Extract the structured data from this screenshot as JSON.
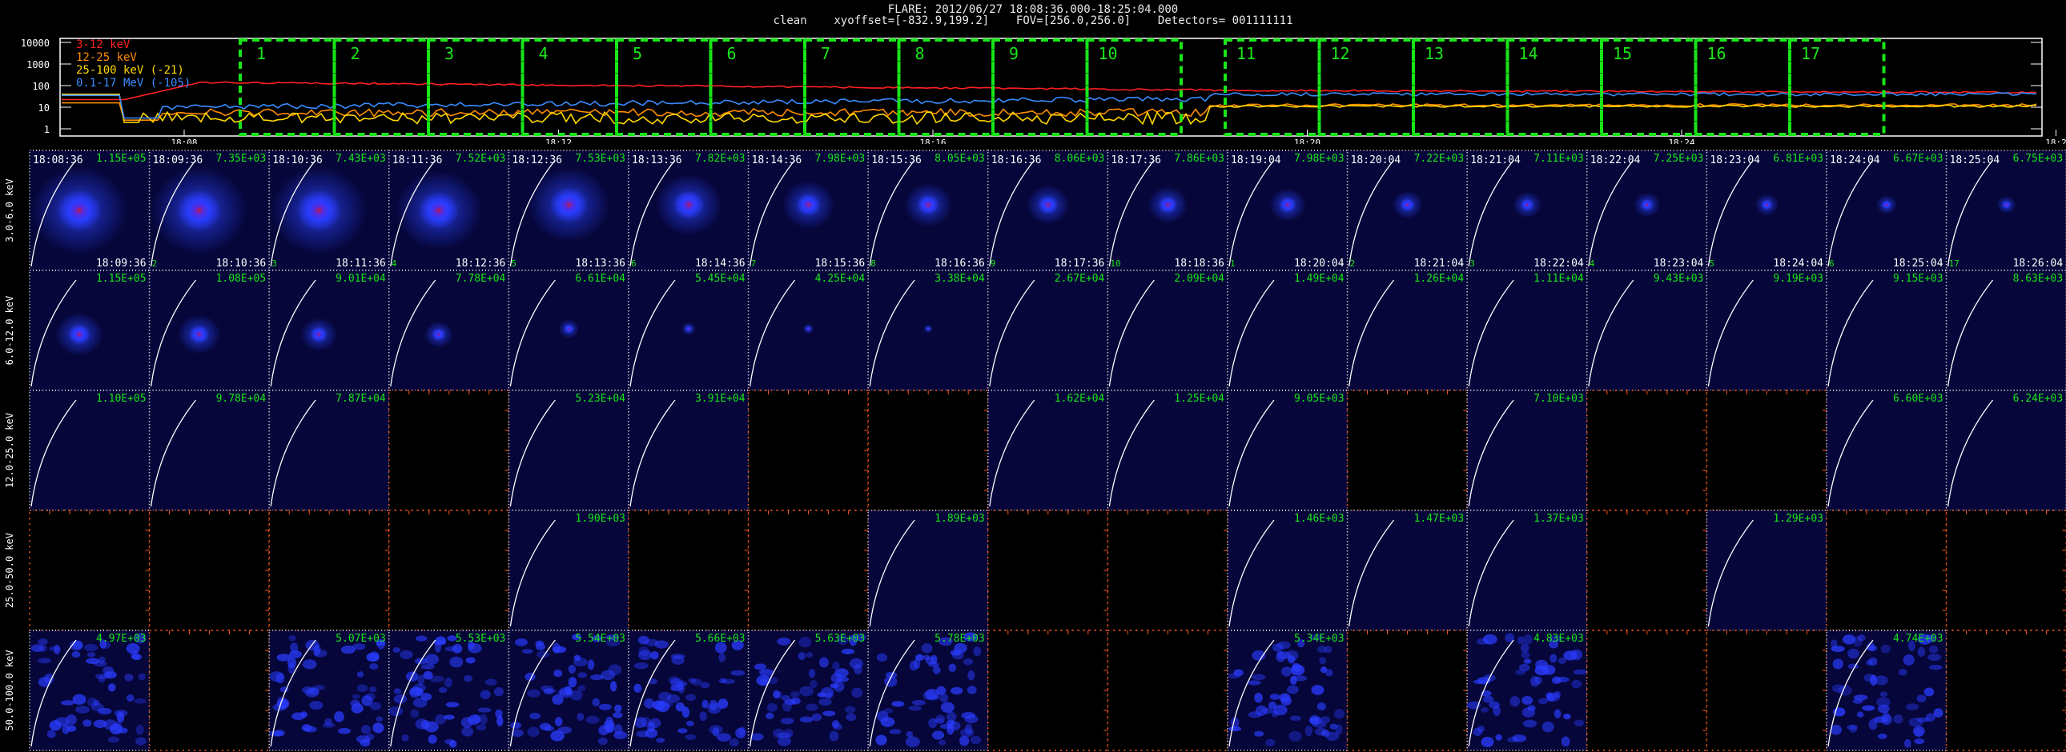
{
  "header": {
    "flare_line": "FLARE: 2012/06/27 18:08:36.000-18:25:04.000",
    "info_line": "clean    xyoffset=[-832.9,199.2]    FOV=[256.0,256.0]    Detectors= 001111111"
  },
  "lightcurve": {
    "legend": [
      {
        "label": "3-12 keV",
        "color": "#ff2020"
      },
      {
        "label": "12-25 keV",
        "color": "#ff8c00"
      },
      {
        "label": "25-100 keV (-21)",
        "color": "#ffd800"
      },
      {
        "label": "0.1-17 MeV (-105)",
        "color": "#3a8cff"
      }
    ],
    "y_ticks": [
      "10000",
      "1000",
      "100",
      "10",
      "1"
    ],
    "time_ticks": [
      "18:08",
      "18:12",
      "18:16",
      "18:20",
      "18:24",
      "18:2"
    ],
    "intervals": [
      "1",
      "2",
      "3",
      "4",
      "5",
      "6",
      "7",
      "8",
      "9",
      "10",
      "11",
      "12",
      "13",
      "14",
      "15",
      "16",
      "17"
    ],
    "interval_color": "#19e619"
  },
  "energy_bands": [
    "3.0-6.0 keV",
    "6.0-12.0 keV",
    "12.0-25.0 keV",
    "25.0-50.0 keV",
    "50.0-100.0 keV"
  ],
  "rows": [
    {
      "starts": [
        "18:08:36",
        "18:09:36",
        "18:10:36",
        "18:11:36",
        "18:12:36",
        "18:13:36",
        "18:14:36",
        "18:15:36",
        "18:16:36",
        "18:17:36",
        "18:19:04",
        "18:20:04",
        "18:21:04",
        "18:22:04",
        "18:23:04",
        "18:24:04",
        "18:25:04"
      ],
      "ends": [
        "18:09:36",
        "18:10:36",
        "18:11:36",
        "18:12:36",
        "18:13:36",
        "18:14:36",
        "18:15:36",
        "18:16:36",
        "18:17:36",
        "18:18:36",
        "18:20:04",
        "18:21:04",
        "18:22:04",
        "18:23:04",
        "18:24:04",
        "18:25:04",
        "18:26:04"
      ],
      "values": [
        "1.15E+05",
        "7.35E+03",
        "7.43E+03",
        "7.52E+03",
        "7.53E+03",
        "7.82E+03",
        "7.98E+03",
        "8.05E+03",
        "8.06E+03",
        "7.86E+03",
        "7.98E+03",
        "7.22E+03",
        "7.11E+03",
        "7.25E+03",
        "6.81E+03",
        "6.67E+03",
        "6.75E+03"
      ],
      "indices": [
        "",
        "2",
        "3",
        "4",
        "5",
        "6",
        "7",
        "8",
        "9",
        "10",
        "1",
        "2",
        "3",
        "4",
        "5",
        "6",
        "17"
      ],
      "panels": [
        "img",
        "img",
        "img",
        "img",
        "img",
        "img",
        "img",
        "img",
        "img",
        "img",
        "img",
        "img",
        "img",
        "img",
        "img",
        "img",
        "img"
      ],
      "blob": [
        1.0,
        1.0,
        1.0,
        0.9,
        0.85,
        0.7,
        0.55,
        0.5,
        0.45,
        0.42,
        0.38,
        0.32,
        0.3,
        0.28,
        0.25,
        0.22,
        0.2
      ]
    },
    {
      "values": [
        "1.15E+05",
        "1.08E+05",
        "9.01E+04",
        "7.78E+04",
        "6.61E+04",
        "5.45E+04",
        "4.25E+04",
        "3.38E+04",
        "2.67E+04",
        "2.09E+04",
        "1.49E+04",
        "1.26E+04",
        "1.11E+04",
        "9.43E+03",
        "9.19E+03",
        "9.15E+03",
        "8.63E+03"
      ],
      "panels": [
        "img",
        "img",
        "img",
        "img",
        "img",
        "img",
        "img",
        "img",
        "img",
        "img",
        "img",
        "img",
        "img",
        "img",
        "img",
        "img",
        "img"
      ],
      "blob": [
        0.5,
        0.45,
        0.38,
        0.3,
        0.22,
        0.15,
        0.12,
        0.1,
        0.0,
        0.0,
        0.0,
        0.0,
        0.0,
        0.0,
        0.0,
        0.0,
        0.0
      ]
    },
    {
      "values": [
        "1.10E+05",
        "9.78E+04",
        "7.87E+04",
        "",
        "5.23E+04",
        "3.91E+04",
        "",
        "",
        "1.62E+04",
        "1.25E+04",
        "9.05E+03",
        "",
        "7.10E+03",
        "",
        "",
        "6.60E+03",
        "6.24E+03"
      ],
      "panels": [
        "img",
        "img",
        "img",
        "empty",
        "img",
        "img",
        "empty",
        "empty",
        "img",
        "img",
        "img",
        "empty",
        "img",
        "empty",
        "empty",
        "img",
        "img"
      ],
      "blob": [
        0,
        0,
        0,
        0,
        0,
        0,
        0,
        0,
        0,
        0,
        0,
        0,
        0,
        0,
        0,
        0,
        0
      ]
    },
    {
      "values": [
        "",
        "",
        "",
        "",
        "1.90E+03",
        "",
        "",
        "1.89E+03",
        "",
        "",
        "1.46E+03",
        "1.47E+03",
        "1.37E+03",
        "",
        "1.29E+03",
        "",
        ""
      ],
      "panels": [
        "empty",
        "empty",
        "empty",
        "empty",
        "img",
        "empty",
        "empty",
        "img",
        "empty",
        "empty",
        "img",
        "img",
        "img",
        "empty",
        "img",
        "empty",
        "empty"
      ],
      "blob": [
        0,
        0,
        0,
        0,
        0,
        0,
        0,
        0,
        0,
        0,
        0,
        0,
        0,
        0,
        0,
        0,
        0
      ]
    },
    {
      "values": [
        "4.97E+03",
        "",
        "5.07E+03",
        "5.53E+03",
        "5.54E+03",
        "5.66E+03",
        "5.63E+03",
        "5.78E+03",
        "",
        "",
        "5.34E+03",
        "",
        "4.83E+03",
        "",
        "",
        "4.74E+03",
        ""
      ],
      "panels": [
        "noise",
        "empty",
        "noise",
        "noise",
        "noise",
        "noise",
        "noise",
        "noise",
        "empty",
        "empty",
        "noise",
        "empty",
        "noise",
        "empty",
        "empty",
        "noise",
        "empty"
      ],
      "blob": [
        0,
        0,
        0,
        0,
        0,
        0,
        0,
        0,
        0,
        0,
        0,
        0,
        0,
        0,
        0,
        0,
        0
      ]
    }
  ],
  "colors": {
    "panel_bg": "#06063a",
    "axis_white": "#ffffff",
    "axis_orange": "#ff5a1e",
    "value_green": "#19e619",
    "time_white": "#ffffff",
    "blob_blue": "#2a3cff",
    "blob_core": "#c01a4a",
    "limb_line": "#ffffff"
  }
}
